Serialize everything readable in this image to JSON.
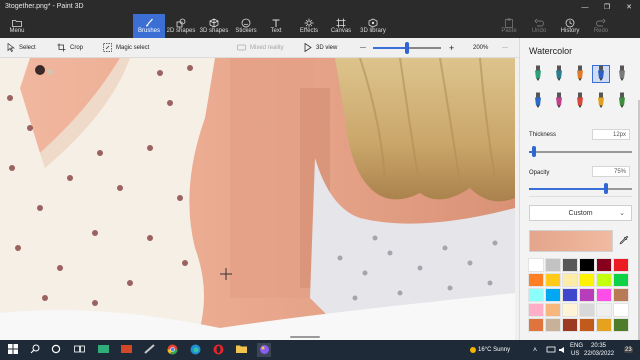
{
  "window": {
    "title": "3together.png* - Paint 3D",
    "minimize": "—",
    "maximize": "❐",
    "close": "✕"
  },
  "ribbon": {
    "menu_label": "Menu",
    "tabs": [
      {
        "label": "Brushes",
        "icon": "brush-icon"
      },
      {
        "label": "2D shapes",
        "icon": "2d-shapes-icon"
      },
      {
        "label": "3D shapes",
        "icon": "3d-shapes-icon"
      },
      {
        "label": "Stickers",
        "icon": "stickers-icon"
      },
      {
        "label": "Text",
        "icon": "text-icon"
      },
      {
        "label": "Effects",
        "icon": "effects-icon"
      },
      {
        "label": "Canvas",
        "icon": "canvas-icon"
      },
      {
        "label": "3D library",
        "icon": "3d-library-icon"
      }
    ],
    "right_buttons": [
      {
        "label": "Paste",
        "disabled": true
      },
      {
        "label": "Undo",
        "disabled": true
      },
      {
        "label": "History",
        "disabled": false
      },
      {
        "label": "Redo",
        "disabled": true
      }
    ]
  },
  "toolbar": {
    "select": "Select",
    "crop": "Crop",
    "magic_select": "Magic select",
    "mixed_reality": "Mixed reality",
    "view_3d": "3D view",
    "zoom_minus": "—",
    "zoom_plus": "+",
    "zoom_level": "200%",
    "zoom_fraction": 0.48,
    "more": "···"
  },
  "panel": {
    "title": "Watercolor",
    "brushes": [
      {
        "name": "marker",
        "color": "#2fa07a",
        "selected": false
      },
      {
        "name": "calligraphy-pen",
        "color": "#2a7d8f",
        "selected": false
      },
      {
        "name": "oil-brush",
        "color": "#e07a2c",
        "selected": false
      },
      {
        "name": "watercolor",
        "color": "#2b5fc4",
        "selected": true
      },
      {
        "name": "pixel-pen",
        "color": "#7a7a7a",
        "selected": false
      },
      {
        "name": "pencil",
        "color": "#2d68c8",
        "selected": false
      },
      {
        "name": "eraser",
        "color": "#c0408a",
        "selected": false
      },
      {
        "name": "crayon",
        "color": "#d9473a",
        "selected": false
      },
      {
        "name": "spray-can",
        "color": "#e0a020",
        "selected": false
      },
      {
        "name": "fill",
        "color": "#3f8d3f",
        "selected": false
      }
    ],
    "thickness_label": "Thickness",
    "thickness_value": "12px",
    "thickness_fraction": 0.05,
    "opacity_label": "Opacity",
    "opacity_value": "75%",
    "opacity_fraction": 0.75,
    "color_mode": "Custom",
    "current_color": "#e3a58b",
    "palette": [
      "#ffffff",
      "#c3c3c3",
      "#585858",
      "#000000",
      "#88001b",
      "#ec1c24",
      "#ff7f27",
      "#ffca18",
      "#fdeca6",
      "#fff200",
      "#c4ff0e",
      "#0ed145",
      "#8cfffb",
      "#00a8f3",
      "#3f48cc",
      "#b83dba",
      "#ff4ee8",
      "#b97a56",
      "#ffaec8",
      "#f7b77c",
      "#fff5d6",
      "#d8d8d8",
      "#f0f0f0",
      "#ffffff",
      "#e0743d",
      "#c7b299",
      "#9c3a22",
      "#c15a1a",
      "#e6a11e",
      "#4d7c2b"
    ]
  },
  "taskbar": {
    "weather": "16°C  Sunny",
    "lang": "ENG",
    "region": "US",
    "time": "20:35",
    "date": "22/03/2022",
    "notifications": "23"
  }
}
